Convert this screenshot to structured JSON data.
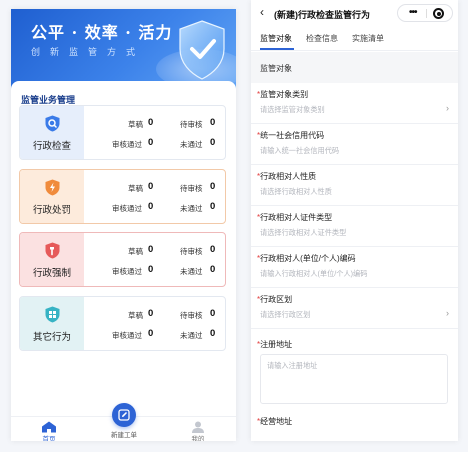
{
  "left": {
    "hero": {
      "slogan": "公平 · 效率 · 活力",
      "subtitle": "创新监管方式"
    },
    "section_title": "监管业务管理",
    "stat_labels": {
      "draft": "草稿",
      "pending": "待审核",
      "approved": "审核通过",
      "rejected": "未通过"
    },
    "cards": [
      {
        "name": "行政检查",
        "icon": "search-shield-icon",
        "color": "#3b7be8",
        "draft": "0",
        "pending": "0",
        "approved": "0",
        "rejected": "0"
      },
      {
        "name": "行政处罚",
        "icon": "lightning-shield-icon",
        "color": "#f08b3c",
        "draft": "0",
        "pending": "0",
        "approved": "0",
        "rejected": "0"
      },
      {
        "name": "行政强制",
        "icon": "hammer-shield-icon",
        "color": "#e65a5a",
        "draft": "0",
        "pending": "0",
        "approved": "0",
        "rejected": "0"
      },
      {
        "name": "其它行为",
        "icon": "grid-shield-icon",
        "color": "#37b3c4",
        "draft": "0",
        "pending": "0",
        "approved": "0",
        "rejected": "0"
      }
    ],
    "tabbar": {
      "home": "首页",
      "new_order": "新建工单",
      "mine": "我的"
    },
    "accent": "#2d63d5"
  },
  "right": {
    "nav_title": "(新建)行政检查监管行为",
    "tabs": [
      "监管对象",
      "检查信息",
      "实施清单"
    ],
    "section_header": "监管对象",
    "fields": [
      {
        "label": "监管对象类别",
        "required": "*",
        "placeholder": "请选择监管对象类别",
        "chevron": true
      },
      {
        "label": "统一社会信用代码",
        "required": "*",
        "placeholder": "请输入统一社会信用代码",
        "chevron": false
      },
      {
        "label": "行政相对人性质",
        "required": "*",
        "placeholder": "请选择行政相对人性质",
        "chevron": false
      },
      {
        "label": "行政相对人证件类型",
        "required": "*",
        "placeholder": "请选择行政相对人证件类型",
        "chevron": false
      },
      {
        "label": "行政相对人(单位/个人)编码",
        "required": "*",
        "placeholder": "请输入行政相对人(单位/个人)编码",
        "chevron": false
      },
      {
        "label": "行政区划",
        "required": "*",
        "placeholder": "请选择行政区划",
        "chevron": true
      }
    ],
    "address_field": {
      "label": "注册地址",
      "required": "*",
      "placeholder": "请输入注册地址"
    },
    "business_field": {
      "label": "经营地址",
      "required": "*"
    }
  }
}
